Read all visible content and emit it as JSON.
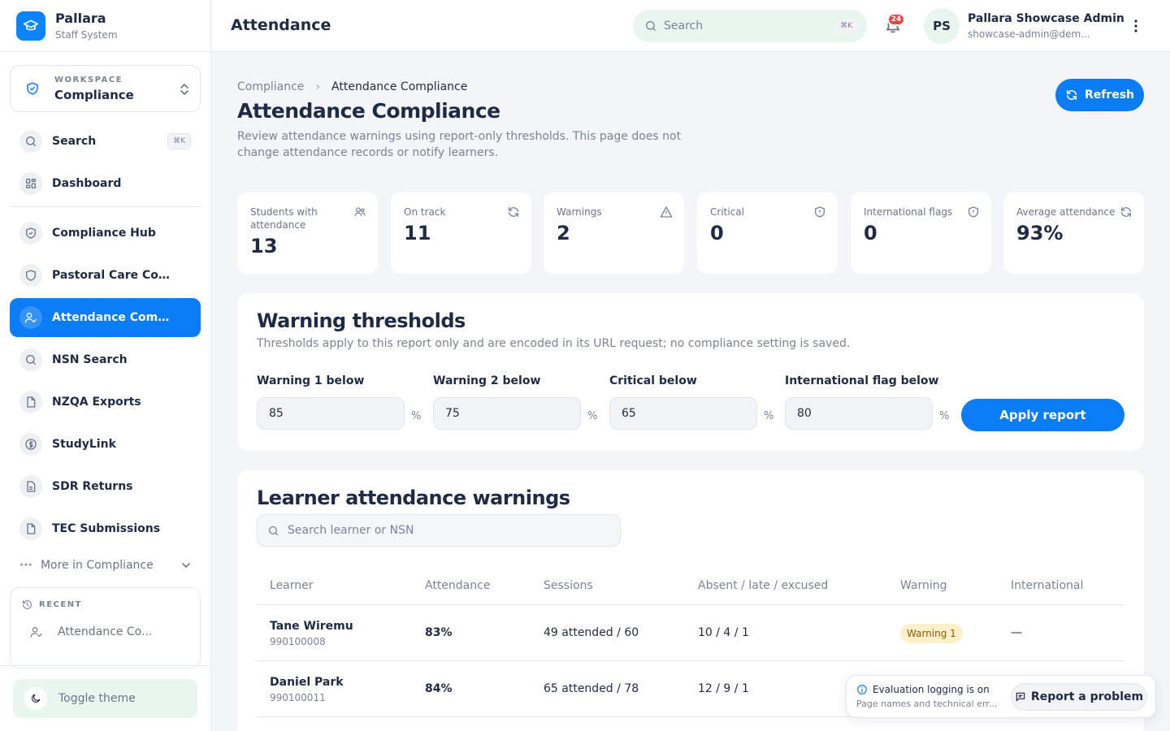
{
  "brand": {
    "name": "Pallara",
    "subtitle": "Staff System"
  },
  "workspace": {
    "label": "WORKSPACE",
    "value": "Compliance"
  },
  "sidebar": {
    "search_label": "Search",
    "search_shortcut": "⌘K",
    "items": [
      {
        "label": "Dashboard",
        "icon": "grid-icon"
      },
      {
        "label": "Compliance Hub",
        "icon": "shield-icon"
      },
      {
        "label": "Pastoral Care Code",
        "icon": "shield-icon"
      },
      {
        "label": "Attendance Comp...",
        "icon": "user-check-icon",
        "active": true
      },
      {
        "label": "NSN Search",
        "icon": "search-icon"
      },
      {
        "label": "NZQA Exports",
        "icon": "file-icon"
      },
      {
        "label": "StudyLink",
        "icon": "dollar-icon"
      },
      {
        "label": "SDR Returns",
        "icon": "document-icon"
      },
      {
        "label": "TEC Submissions",
        "icon": "file-icon"
      }
    ],
    "more_label": "More in Compliance",
    "recent_label": "RECENT",
    "recent_item": "Attendance Co...",
    "toggle_theme": "Toggle theme"
  },
  "topbar": {
    "title": "Attendance",
    "search_placeholder": "Search",
    "search_shortcut": "⌘K",
    "notification_count": "24",
    "avatar_initials": "PS",
    "user_name": "Pallara Showcase Admin",
    "user_email": "showcase-admin@dem..."
  },
  "page": {
    "breadcrumb_parent": "Compliance",
    "breadcrumb_sep": "›",
    "breadcrumb_current": "Attendance Compliance",
    "title": "Attendance Compliance",
    "description": "Review attendance warnings using report-only thresholds. This page does not change attendance records or notify learners.",
    "refresh_label": "Refresh"
  },
  "stats": [
    {
      "label": "Students with attendance",
      "value": "13",
      "icon": "users-icon"
    },
    {
      "label": "On track",
      "value": "11",
      "icon": "refresh-icon"
    },
    {
      "label": "Warnings",
      "value": "2",
      "icon": "alert-triangle-icon"
    },
    {
      "label": "Critical",
      "value": "0",
      "icon": "shield-alert-icon"
    },
    {
      "label": "International flags",
      "value": "0",
      "icon": "shield-alert-icon"
    },
    {
      "label": "Average attendance",
      "value": "93%",
      "icon": "refresh-icon"
    }
  ],
  "thresholds": {
    "title": "Warning thresholds",
    "subtitle": "Thresholds apply to this report only and are encoded in its URL request; no compliance setting is saved.",
    "fields": [
      {
        "label": "Warning 1 below",
        "value": "85",
        "unit": "%"
      },
      {
        "label": "Warning 2 below",
        "value": "75",
        "unit": "%"
      },
      {
        "label": "Critical below",
        "value": "65",
        "unit": "%"
      },
      {
        "label": "International flag below",
        "value": "80",
        "unit": "%"
      }
    ],
    "apply_label": "Apply report"
  },
  "learners": {
    "title": "Learner attendance warnings",
    "search_placeholder": "Search learner or NSN",
    "columns": [
      "Learner",
      "Attendance",
      "Sessions",
      "Absent / late / excused",
      "Warning",
      "International"
    ],
    "rows": [
      {
        "name": "Tane Wiremu",
        "nsn": "990100008",
        "attendance": "83%",
        "sessions": "49 attended / 60",
        "absent": "10 / 4 / 1",
        "warning": "Warning 1",
        "international": "—"
      },
      {
        "name": "Daniel Park",
        "nsn": "990100011",
        "attendance": "84%",
        "sessions": "65 attended / 78",
        "absent": "12 / 9 / 1",
        "warning": "",
        "international": ""
      }
    ]
  },
  "toast": {
    "title": "Evaluation logging is on",
    "body": "Page names and technical err...",
    "report_label": "Report a problem"
  },
  "colors": {
    "accent": "#0a7cf5",
    "mint": "#e8f6ef",
    "warning_bg": "#fdf1cc",
    "badge_red": "#ef4444"
  }
}
